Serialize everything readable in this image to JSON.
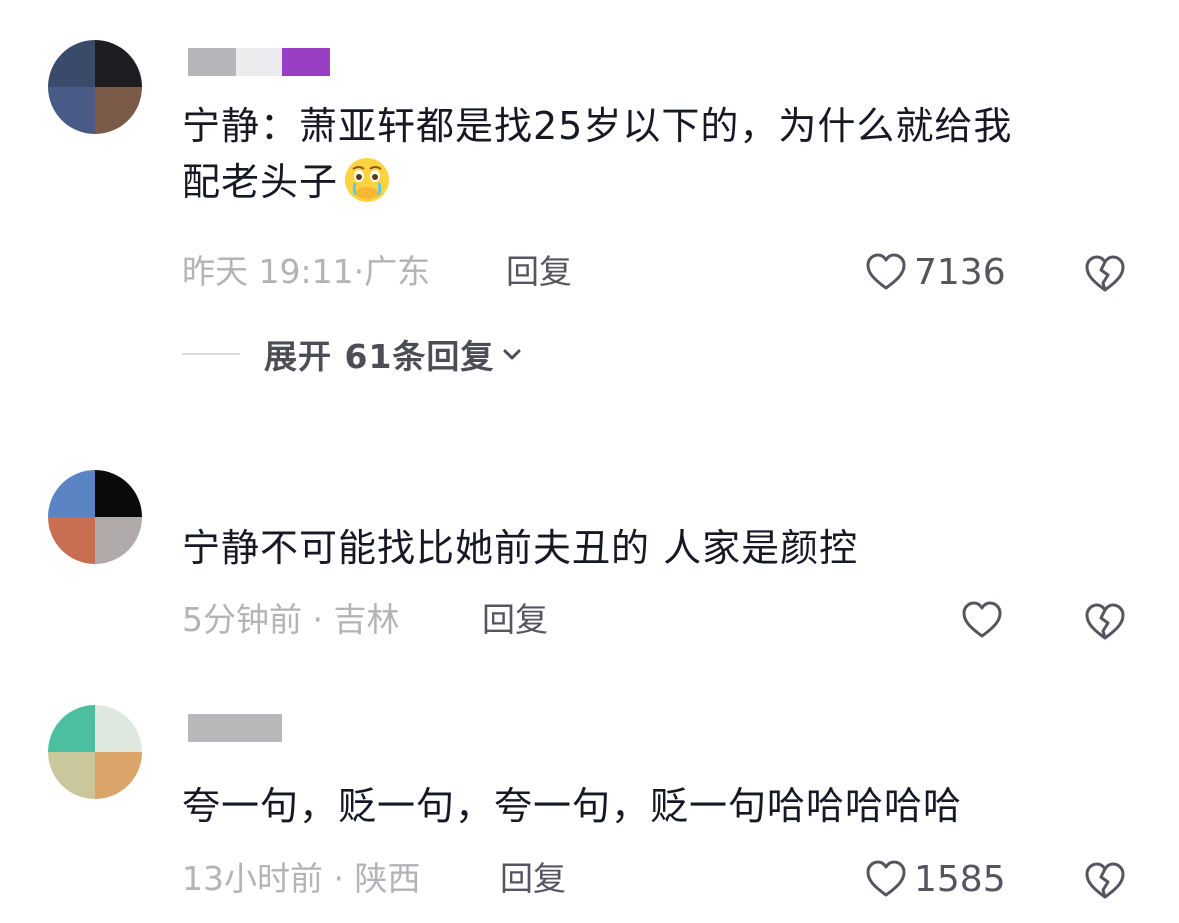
{
  "colors": {
    "text_primary": "#161823",
    "text_meta": "#b3b3b8",
    "text_action": "#555560",
    "background": "#ffffff"
  },
  "comments": [
    {
      "text_line1": "宁静：萧亚轩都是找25岁以下的，为什么就给我",
      "text_line2": "配老头子",
      "emoji": "crying-with-hand-over-mouth-emoji",
      "time": "昨天 19:11",
      "location_sep": "·",
      "location": "广东",
      "reply_label": "回复",
      "likes": "7136",
      "expand_label": "展开 61条回复"
    },
    {
      "text": "宁静不可能找比她前夫丑的 人家是颜控",
      "time": "5分钟前",
      "location_sep": " · ",
      "location": "吉林",
      "reply_label": "回复",
      "likes": ""
    },
    {
      "text": "夸一句，贬一句，夸一句，贬一句哈哈哈哈哈",
      "time": "13小时前",
      "location_sep": " · ",
      "location": "陕西",
      "reply_label": "回复",
      "likes": "1585"
    }
  ]
}
